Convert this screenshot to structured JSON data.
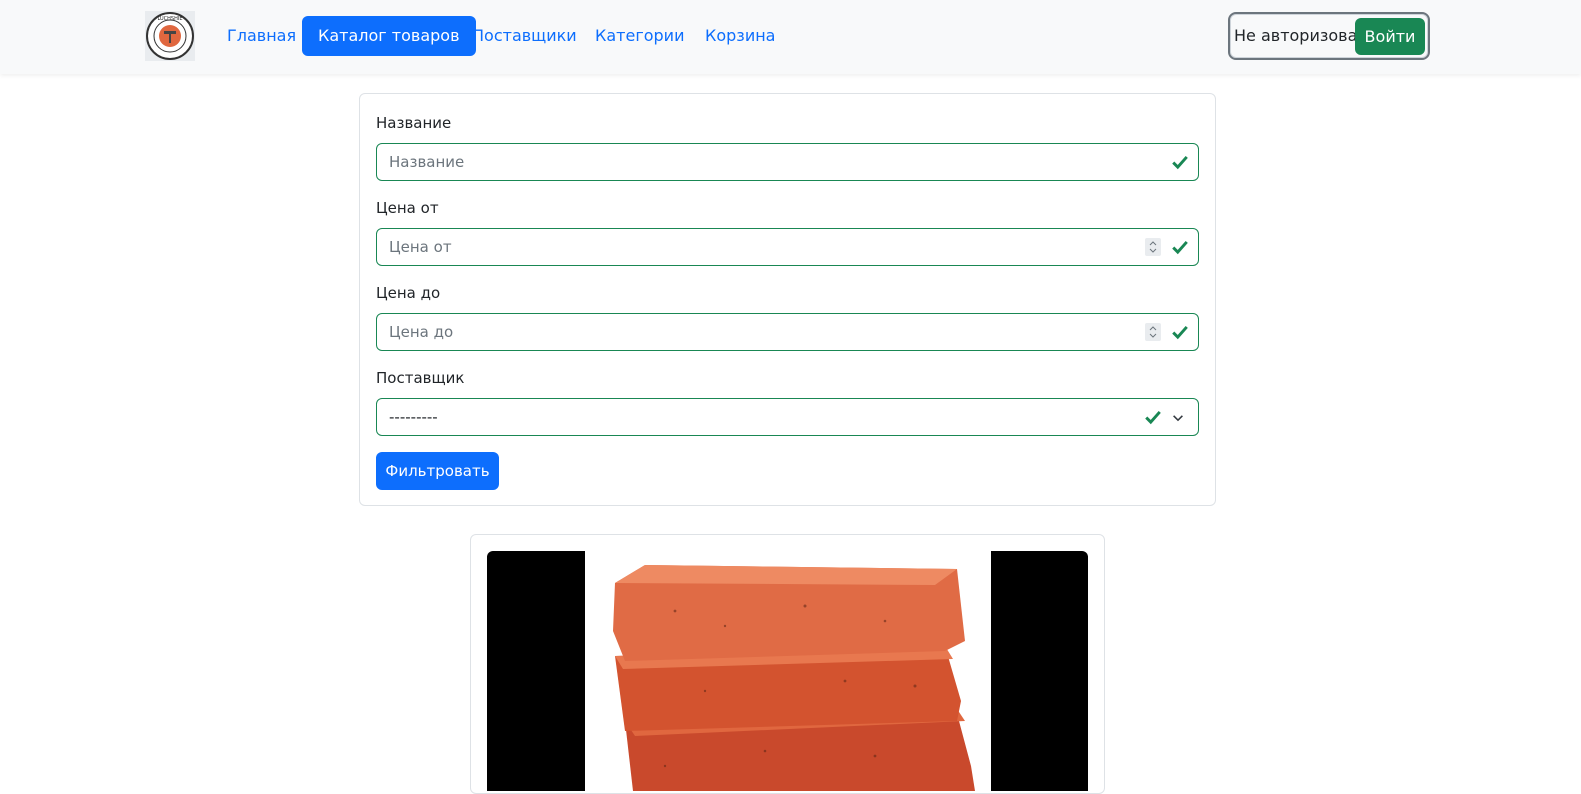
{
  "nav": {
    "items": [
      {
        "label": "Главная",
        "active": false
      },
      {
        "label": "Каталог товаров",
        "active": true
      },
      {
        "label": "Поставщики",
        "active": false
      },
      {
        "label": "Категории",
        "active": false
      },
      {
        "label": "Корзина",
        "active": false
      }
    ],
    "auth_status": "Не авторизован",
    "login_label": "Войти",
    "logo_text": "LUCHSHIE STROYMATERIALY"
  },
  "filter": {
    "name": {
      "label": "Название",
      "placeholder": "Название"
    },
    "price_from": {
      "label": "Цена от",
      "placeholder": "Цена от"
    },
    "price_to": {
      "label": "Цена до",
      "placeholder": "Цена до"
    },
    "supplier": {
      "label": "Поставщик",
      "value": "---------"
    },
    "submit_label": "Фильтровать"
  },
  "product": {
    "image": "brick-stack-image"
  },
  "colors": {
    "primary": "#0d6efd",
    "success": "#198754",
    "brick": "#d9583a"
  }
}
